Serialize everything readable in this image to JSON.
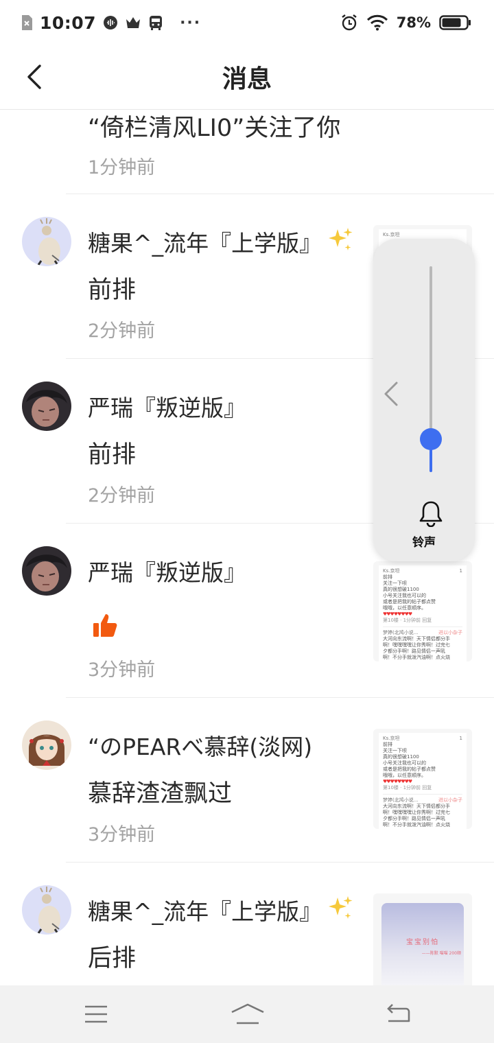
{
  "status_bar": {
    "time": "10:07",
    "battery_percent": "78%",
    "overflow": "···",
    "battery_level": 0.78
  },
  "header": {
    "title": "消息"
  },
  "messages": [
    {
      "name": "“倚栏清风LI0”关注了你",
      "content": "",
      "time": "1分钟前"
    },
    {
      "name": "糖果^_流年『上学版』",
      "content": "前排",
      "time": "2分钟前",
      "sparkle": "✨"
    },
    {
      "name": "严瑞『叛逆版』",
      "content": "前排",
      "time": "2分钟前"
    },
    {
      "name": "严瑞『叛逆版』",
      "content": "",
      "time": "3分钟前",
      "reaction_icon": "thumbs-up-icon"
    },
    {
      "name": "“のPEARべ慕辞(淡网)",
      "content": "慕辞渣渣飘过",
      "time": "3分钟前"
    },
    {
      "name": "糖果^_流年『上学版』",
      "content": "后排",
      "time": "",
      "sparkle": "✨"
    }
  ],
  "thumbnail_text": {
    "user": "Ks.京坦",
    "likes": "1",
    "line1": "前排",
    "line2": "关注一下呗",
    "line3": "真的很想破1100",
    "line4": "小号关注我也可以的",
    "line5": "或者是把我的帖子都点赞",
    "line6": "哦哦，以任意顺序。",
    "hearts": "♥♥♥♥♥♥♥♥",
    "meta": "第10楼 · 1分钟前  回复",
    "user2": "梦婷(北鸠小说...",
    "tag2": "进以小杂子",
    "line7": "大河向东流啊！天下情侣都分手",
    "line8": "啊！嘿嘿嘿嘿让你秀啊！过完七",
    "line9": "夕都分手啊！路见情侣一声吼",
    "line10": "啊！不分手就泼汽油啊！点火烧",
    "card_text": "宝宝别怕",
    "card_sub": "——陈默  喵喵 200顺"
  },
  "volume_panel": {
    "label": "铃声",
    "level": 0.16,
    "accent": "#3e6ef0"
  },
  "colors": {
    "secondary_text": "#a3a3a3",
    "like_orange": "#f25a10"
  }
}
